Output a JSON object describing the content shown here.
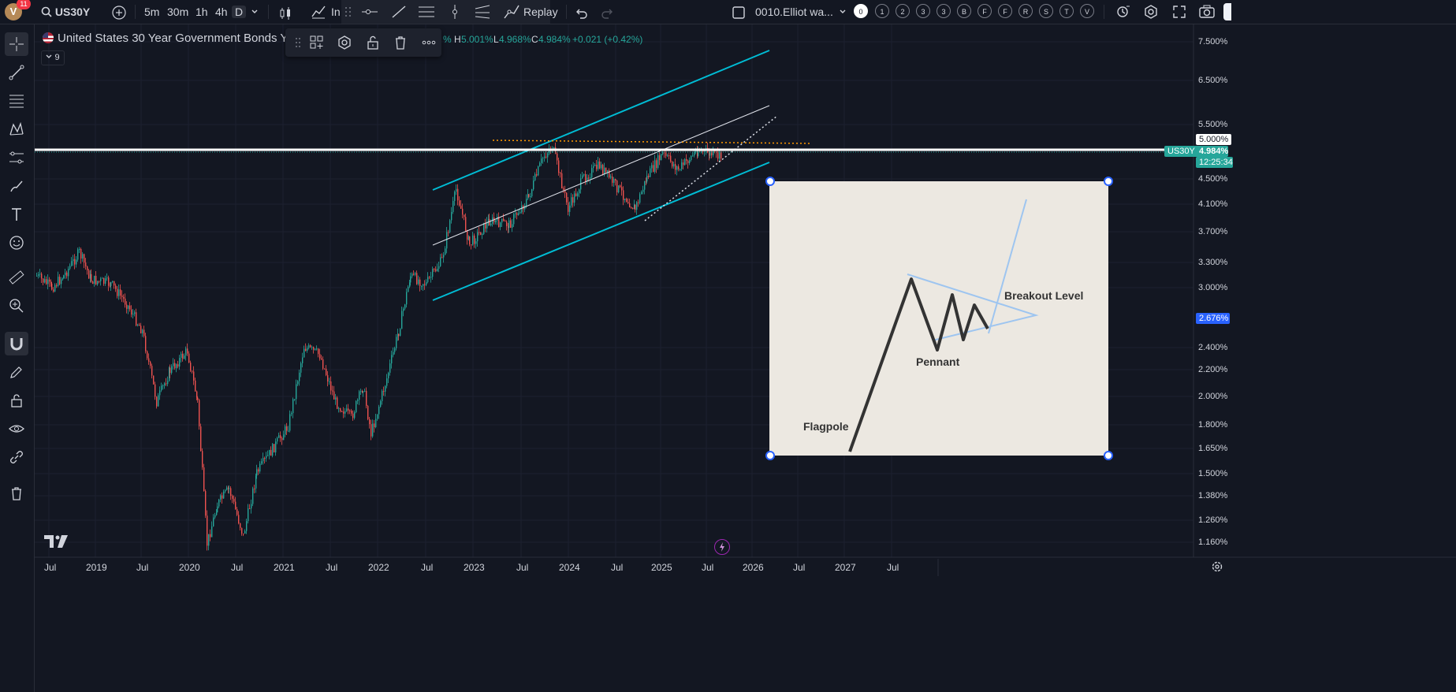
{
  "topbar": {
    "avatar_letter": "V",
    "notif_count": "11",
    "symbol": "US30Y",
    "timeframes": [
      "5m",
      "30m",
      "1h",
      "4h",
      "D"
    ],
    "active_timeframe": "D",
    "indicators_label": "In",
    "replay_label": "Replay",
    "layout_name": "0010.Elliot wa...",
    "wave_labels": [
      "0",
      "1",
      "2",
      "3",
      "3",
      "B",
      "F",
      "F",
      "R",
      "S",
      "T",
      "V"
    ]
  },
  "legend": {
    "title": "United States 30 Year Government Bonds Yi",
    "pct_prefix": "%",
    "h_label": "H",
    "h_value": "5.001%",
    "l_label": "L",
    "l_value": "4.968%",
    "c_label": "C",
    "c_value": "4.984%",
    "change": "+0.021 (+0.42%)",
    "collapse_count": "9"
  },
  "xaxis": {
    "labels": [
      "Jul",
      "2019",
      "Jul",
      "2020",
      "Jul",
      "2021",
      "Jul",
      "2022",
      "Jul",
      "2023",
      "Jul",
      "2024",
      "Jul",
      "2025",
      "Jul",
      "2026",
      "Jul",
      "2027",
      "Jul"
    ]
  },
  "yaxis": {
    "labels": [
      "7.500%",
      "6.500%",
      "5.500%",
      "5.000%",
      "4.500%",
      "4.100%",
      "3.700%",
      "3.300%",
      "3.000%",
      "2.400%",
      "2.200%",
      "2.000%",
      "1.800%",
      "1.650%",
      "1.500%",
      "1.380%",
      "1.260%",
      "1.160%"
    ],
    "price_tag_symbol": "US30Y",
    "price_value": "4.984%",
    "countdown": "12:25:34",
    "crosshair_value": "2.676%",
    "hline_value": "5.000%"
  },
  "reference_image": {
    "flagpole_label": "Flagpole",
    "pennant_label": "Pennant",
    "breakout_label": "Breakout Level"
  },
  "colors": {
    "background": "#131722",
    "up": "#26a69a",
    "down": "#ef5350",
    "channel": "#00bcd4",
    "crosshair_badge": "#2962ff",
    "hline_orange": "#ff9800"
  }
}
